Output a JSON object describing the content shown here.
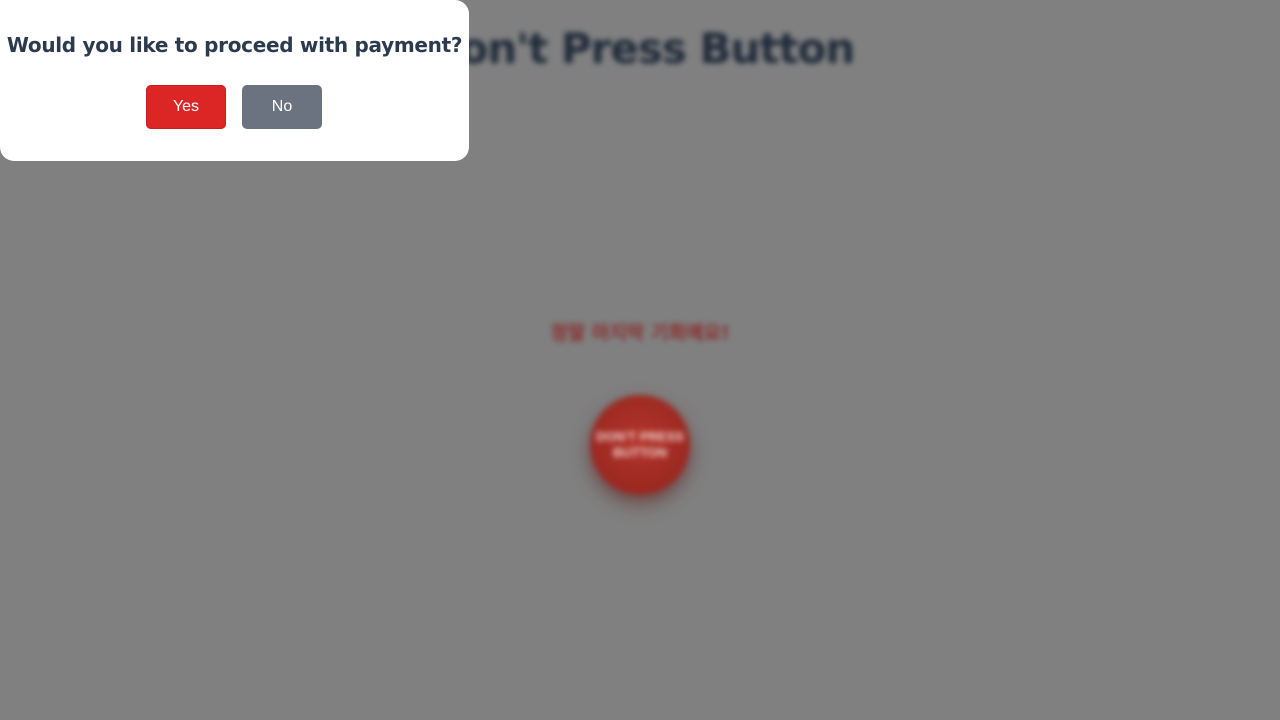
{
  "page": {
    "title": "Don't Press Button",
    "warning": "정말 마지막 기회예요!",
    "big_button_label": "DON'T PRESS BUTTON"
  },
  "dialog": {
    "question": "Would you like to proceed with payment?",
    "yes_label": "Yes",
    "no_label": "No"
  },
  "colors": {
    "yes": "#dc2626",
    "no": "#6b7280",
    "backdrop": "#808080",
    "big_button": "#a52d25"
  }
}
